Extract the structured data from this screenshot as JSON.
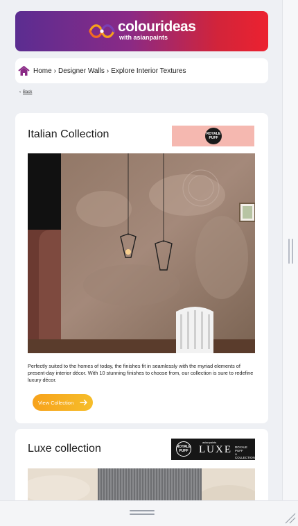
{
  "brand": {
    "name": "colourideas",
    "subline": "with asianpaints"
  },
  "breadcrumb": {
    "items": [
      "Home",
      "Designer Walls",
      "Explore Interior Textures"
    ]
  },
  "back_link": "Back",
  "collections": [
    {
      "title": "Italian Collection",
      "brand_badge": [
        "ROYALE",
        "PUFF"
      ],
      "description": "Perfectly suited to the homes of today, the finishes fit in seamlessly with the myriad elements of present-day interior décor. With 10 stunning finishes to choose from, our collection is sure to redefine luxury décor.",
      "cta": "View Collection"
    },
    {
      "title": "Luxe collection",
      "brand_badge": [
        "ROYALE",
        "PUFF"
      ],
      "logo_top": "asianpaints",
      "logo_word": "LUXE",
      "logo_side": [
        "ROYALE PUFF",
        "A COLLECTION FROM ROYALE"
      ]
    }
  ],
  "colors": {
    "banner_start": "#5b2d91",
    "banner_end": "#ec2230",
    "cta": "#f7a21b",
    "home_icon": "#8a2a86"
  },
  "icons": [
    "home-icon",
    "chevron-right-icon",
    "chevron-left-icon",
    "arrow-right-icon",
    "drag-handle-icon",
    "resize-grip-icon"
  ]
}
